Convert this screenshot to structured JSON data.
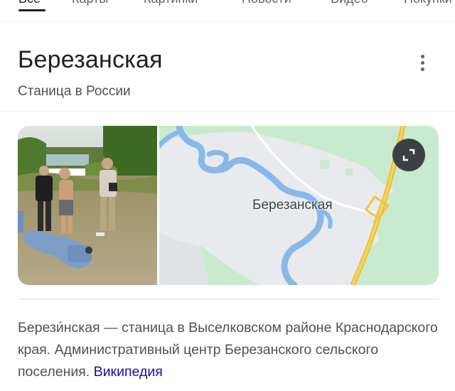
{
  "tabs": [
    {
      "label": "Все",
      "active": true
    },
    {
      "label": "Карты",
      "active": false
    },
    {
      "label": "Картинки",
      "active": false
    },
    {
      "label": "Новости",
      "active": false
    },
    {
      "label": "Видео",
      "active": false
    },
    {
      "label": "Покупки",
      "active": false
    }
  ],
  "knowledge_panel": {
    "title": "Березанская",
    "subtitle": "Станица в России",
    "more_icon": "more-vert-icon",
    "map": {
      "place_label": "Березанская",
      "expand_icon": "expand-icon"
    },
    "description": {
      "text": "Берези́нская — станица в Выселковском районе Краснодарского края. Административный центр Березанского сельского поселения.",
      "source_link": "Википедия"
    }
  },
  "colors": {
    "map_land": "#e8eaed",
    "map_green": "#c8ebcf",
    "map_water": "#88b8e8",
    "map_road": "#f2c037",
    "link": "#1a0dab"
  }
}
